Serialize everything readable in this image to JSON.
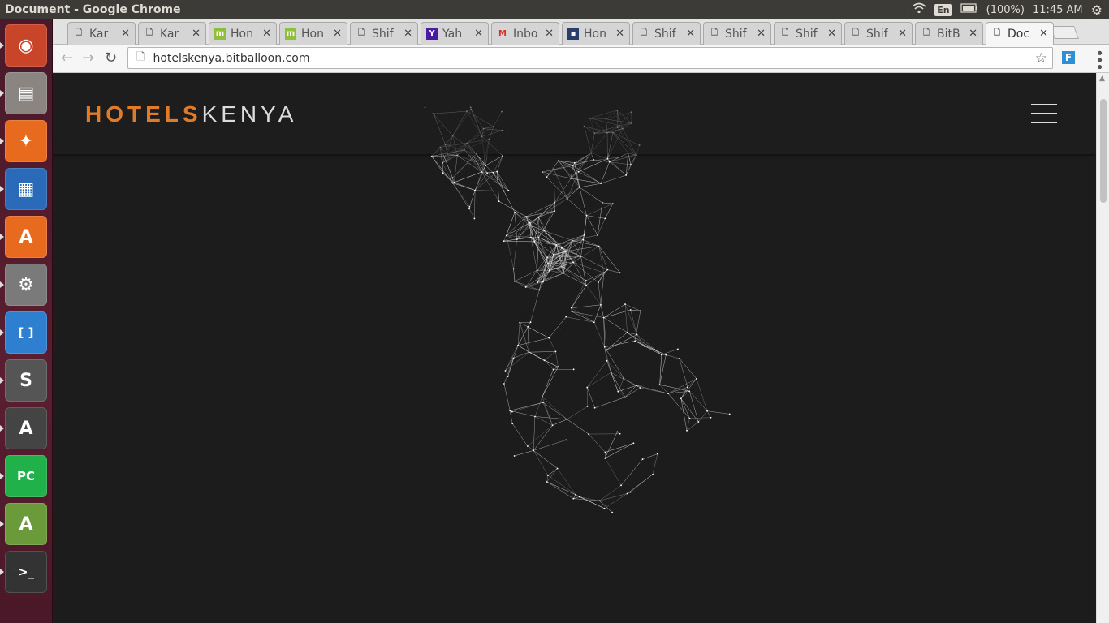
{
  "panel": {
    "window_title": "Document - Google Chrome",
    "language": "En",
    "battery": "(100%)",
    "clock": "11:45 AM"
  },
  "launcher": {
    "apps": [
      {
        "name": "ubuntu-dash",
        "color": "#c8452a",
        "glyph": "◉"
      },
      {
        "name": "files",
        "color": "#8a8580",
        "glyph": "▤"
      },
      {
        "name": "firefox",
        "color": "#e86a1f",
        "glyph": "✦"
      },
      {
        "name": "writer",
        "color": "#2a6ab8",
        "glyph": "▦"
      },
      {
        "name": "software-center",
        "color": "#e86a1f",
        "glyph": "A"
      },
      {
        "name": "system-settings",
        "color": "#7a7a7a",
        "glyph": "⚙"
      },
      {
        "name": "brackets",
        "color": "#2f7fd0",
        "glyph": "[ ]"
      },
      {
        "name": "sublime-text",
        "color": "#555",
        "glyph": "S"
      },
      {
        "name": "software-updater",
        "color": "#444",
        "glyph": "A"
      },
      {
        "name": "pycharm",
        "color": "#21b14a",
        "glyph": "PC"
      },
      {
        "name": "android-studio",
        "color": "#6a9a3a",
        "glyph": "A"
      },
      {
        "name": "terminal",
        "color": "#333",
        "glyph": ">_"
      },
      {
        "name": "chrome",
        "color": "#888",
        "glyph": "◎"
      }
    ]
  },
  "tabs": [
    {
      "title": "Kar",
      "fav": "doc",
      "close": "✕"
    },
    {
      "title": "Kar",
      "fav": "doc",
      "close": "✕"
    },
    {
      "title": "Hon",
      "fav": "m",
      "close": "✕"
    },
    {
      "title": "Hon",
      "fav": "m",
      "close": "✕"
    },
    {
      "title": "Shif",
      "fav": "doc",
      "close": "✕"
    },
    {
      "title": "Yah",
      "fav": "Y",
      "close": "✕"
    },
    {
      "title": "Inbo",
      "fav": "M",
      "close": "✕"
    },
    {
      "title": "Hon",
      "fav": "term",
      "close": "✕"
    },
    {
      "title": "Shif",
      "fav": "doc",
      "close": "✕"
    },
    {
      "title": "Shif",
      "fav": "doc",
      "close": "✕"
    },
    {
      "title": "Shif",
      "fav": "doc",
      "close": "✕"
    },
    {
      "title": "Shif",
      "fav": "doc",
      "close": "✕"
    },
    {
      "title": "BitB",
      "fav": "doc",
      "close": "✕"
    },
    {
      "title": "Doc",
      "fav": "doc",
      "close": "✕",
      "active": true
    }
  ],
  "toolbar": {
    "url": "hotelskenya.bitballoon.com",
    "extension_label": "F"
  },
  "site": {
    "logo_primary": "HOTELS",
    "logo_secondary": "KENYA",
    "accent_color": "#e07b2a",
    "hero_image": "low-poly deer head wireframe"
  }
}
